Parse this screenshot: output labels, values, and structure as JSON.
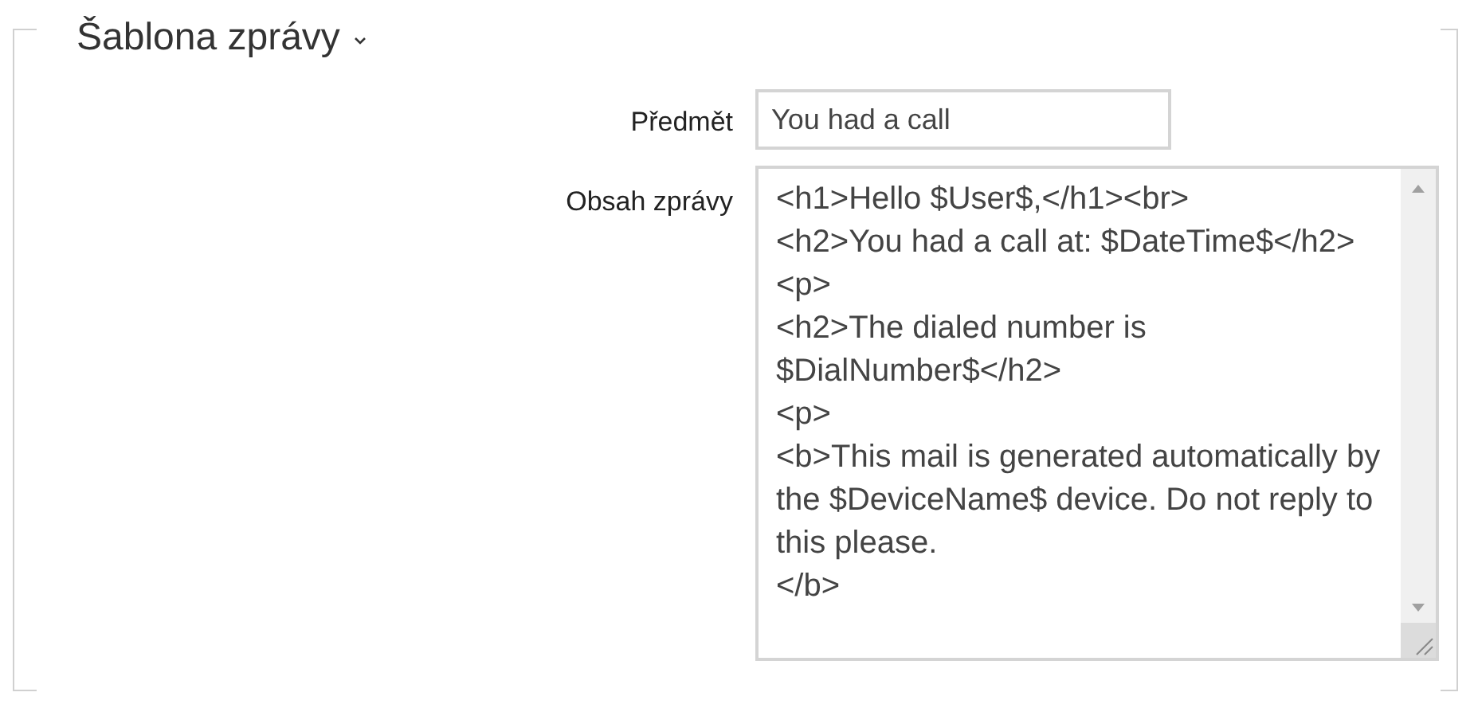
{
  "section": {
    "title": "Šablona zprávy",
    "expanded": true
  },
  "fields": [
    {
      "kind": "input",
      "label": "Předmět",
      "value": "You had a call"
    },
    {
      "kind": "textarea",
      "label": "Obsah zprávy",
      "value": "<h1>Hello $User$,</h1><br>\n<h2>You had a call at: $DateTime$</h2>\n<p>\n<h2>The dialed number is $DialNumber$</h2>\n<p>\n<b>This mail is generated automatically by the $DeviceName$ device. Do not reply to this please.\n</b>"
    }
  ]
}
